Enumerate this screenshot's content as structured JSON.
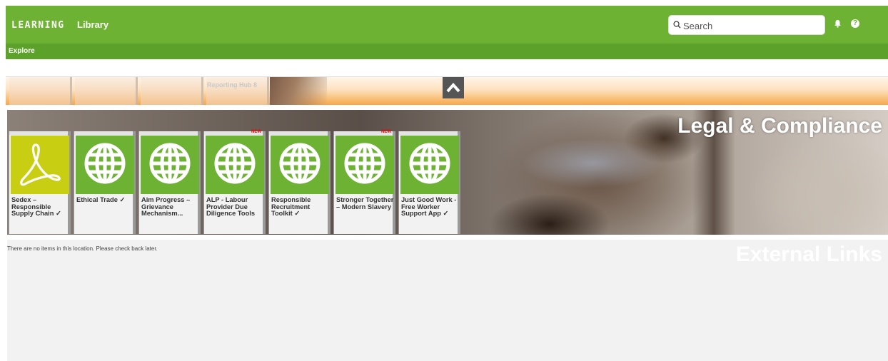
{
  "header": {
    "logo_text": "LEARNING",
    "nav_library": "Library",
    "search_placeholder": "Search",
    "bell_icon": "bell-icon",
    "help_icon": "help-circle-icon",
    "help_glyph": "?"
  },
  "subnav": {
    "explore": "Explore"
  },
  "collapsed_band": {
    "ghost_label": "Reporting Hub 8"
  },
  "legal_section": {
    "title": "Legal & Compliance",
    "tiles": [
      {
        "label": "Sedex – Responsible Supply Chain ✓",
        "icon": "pdf-icon",
        "badge": ""
      },
      {
        "label": "Ethical Trade ✓",
        "icon": "globe-icon",
        "badge": ""
      },
      {
        "label": "Aim Progress – Grievance Mechanism...",
        "icon": "globe-icon",
        "badge": ""
      },
      {
        "label": "ALP - Labour Provider Due Diligence Tools",
        "icon": "globe-icon",
        "badge": "NEW"
      },
      {
        "label": "Responsible Recruitment Toolkit ✓",
        "icon": "globe-icon",
        "badge": ""
      },
      {
        "label": "Stronger Together – Modern Slavery",
        "icon": "globe-icon",
        "badge": "NEW"
      },
      {
        "label": "Just Good Work - Free Worker Support App ✓",
        "icon": "globe-icon",
        "badge": ""
      }
    ]
  },
  "external_section": {
    "title": "External Links",
    "empty_message": "There are no items in this location. Please check back later."
  },
  "colors": {
    "brand_green": "#6db233",
    "pdf_yellow": "#c8cf12",
    "new_badge": "#e00000"
  }
}
